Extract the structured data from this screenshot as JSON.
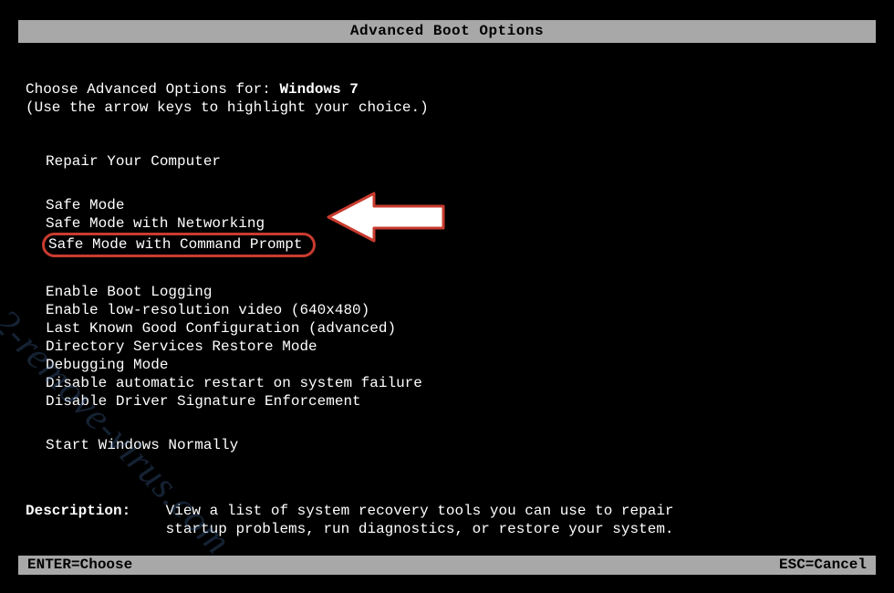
{
  "title": "Advanced Boot Options",
  "prompt_prefix": "Choose Advanced Options for: ",
  "os_name": "Windows 7",
  "hint": "(Use the arrow keys to highlight your choice.)",
  "groups": [
    {
      "items": [
        "Repair Your Computer"
      ]
    },
    {
      "items": [
        "Safe Mode",
        "Safe Mode with Networking",
        "Safe Mode with Command Prompt"
      ],
      "highlighted_index": 2
    },
    {
      "items": [
        "Enable Boot Logging",
        "Enable low-resolution video (640x480)",
        "Last Known Good Configuration (advanced)",
        "Directory Services Restore Mode",
        "Debugging Mode",
        "Disable automatic restart on system failure",
        "Disable Driver Signature Enforcement"
      ]
    },
    {
      "items": [
        "Start Windows Normally"
      ]
    }
  ],
  "description_label": "Description:",
  "description_text_line1": "View a list of system recovery tools you can use to repair",
  "description_text_line2": "startup problems, run diagnostics, or restore your system.",
  "footer_left": "ENTER=Choose",
  "footer_right": "ESC=Cancel",
  "watermark": "2-remove-virus.com"
}
